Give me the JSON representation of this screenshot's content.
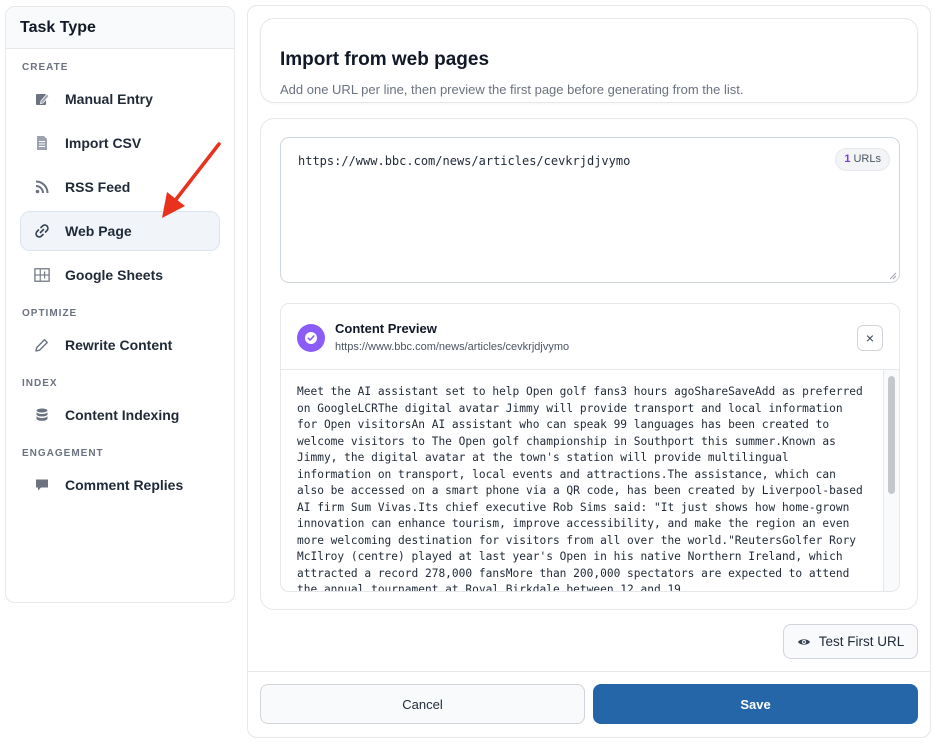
{
  "sidebar": {
    "title": "Task Type",
    "sections": [
      {
        "label": "CREATE",
        "items": [
          {
            "label": "Manual Entry",
            "icon": "edit-note-icon"
          },
          {
            "label": "Import CSV",
            "icon": "document-icon"
          },
          {
            "label": "RSS Feed",
            "icon": "rss-icon"
          },
          {
            "label": "Web Page",
            "icon": "link-icon",
            "active": true
          },
          {
            "label": "Google Sheets",
            "icon": "table-icon"
          }
        ]
      },
      {
        "label": "OPTIMIZE",
        "items": [
          {
            "label": "Rewrite Content",
            "icon": "pencil-icon"
          }
        ]
      },
      {
        "label": "INDEX",
        "items": [
          {
            "label": "Content Indexing",
            "icon": "database-icon"
          }
        ]
      },
      {
        "label": "ENGAGEMENT",
        "items": [
          {
            "label": "Comment Replies",
            "icon": "comment-icon"
          }
        ]
      }
    ]
  },
  "header": {
    "title": "Import from web pages",
    "subtitle": "Add one URL per line, then preview the first page before generating from the list."
  },
  "urls": {
    "value": "https://www.bbc.com/news/articles/cevkrjdjvymo",
    "count": "1",
    "count_label": "URLs"
  },
  "preview": {
    "title": "Content Preview",
    "url": "https://www.bbc.com/news/articles/cevkrjdjvymo",
    "close_label": "×",
    "content": "Meet the AI assistant set to help Open golf fans3 hours agoShareSaveAdd as preferred on GoogleLCRThe digital avatar Jimmy will provide transport and local information for Open visitorsAn AI assistant who can speak 99 languages has been created to welcome visitors to The Open golf championship in Southport this summer.Known as Jimmy, the digital avatar at the town's station will provide multilingual information on transport, local events and attractions.The assistance, which can also be accessed on a smart phone via a QR code, has been created by Liverpool-based AI firm Sum Vivas.Its chief executive Rob Sims said: \"It just shows how home-grown innovation can enhance tourism, improve accessibility, and make the region an even more welcoming destination for visitors from all over the world.\"ReutersGolfer Rory McIlroy (centre) played at last year's Open in his native Northern Ireland, which attracted a record 278,000 fansMore than 200,000 spectators are expected to attend the annual tournament at Royal Birkdale between 12 and 19"
  },
  "actions": {
    "test_label": "Test First URL",
    "cancel_label": "Cancel",
    "save_label": "Save"
  },
  "colors": {
    "accent": "#2566a8",
    "badge_purple": "#8b5cf6",
    "annotation_arrow": "#e8321e"
  }
}
